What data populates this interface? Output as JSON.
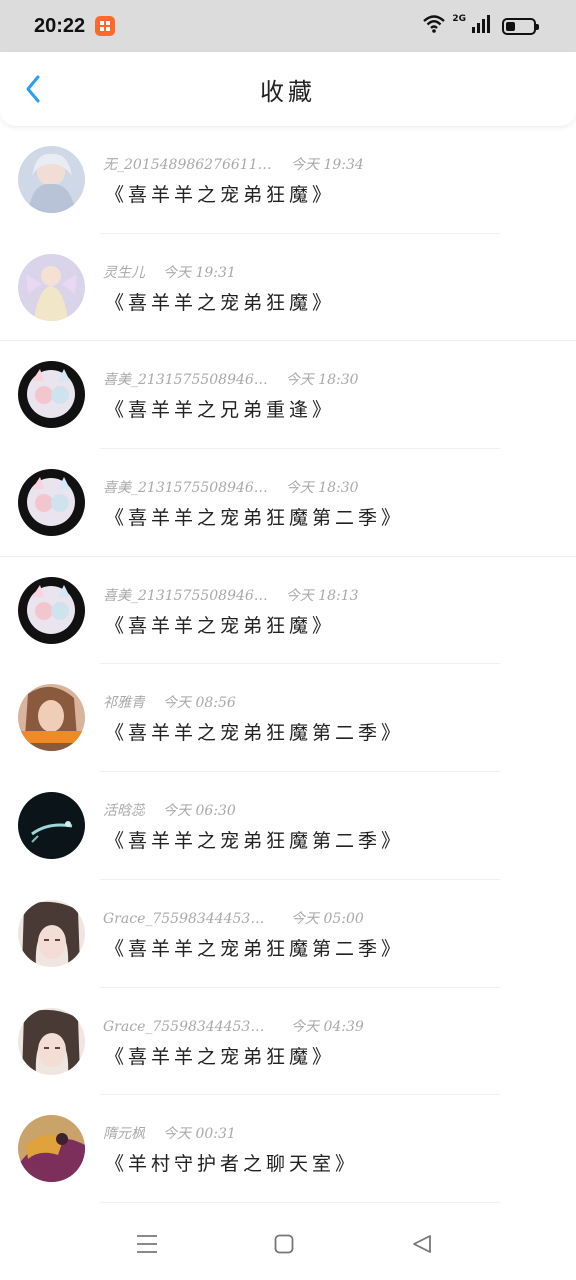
{
  "status_bar": {
    "time": "20:22",
    "network": "2G"
  },
  "header": {
    "title": "收藏"
  },
  "favorites": [
    {
      "name": "无_201548986276611157",
      "time": "今天 19:34",
      "title": "《喜羊羊之宠弟狂魔》"
    },
    {
      "name": "灵生儿",
      "time": "今天 19:31",
      "title": "《喜羊羊之宠弟狂魔》"
    },
    {
      "name": "喜美_2131575508946…",
      "time": "今天 18:30",
      "title": "《喜羊羊之兄弟重逢》"
    },
    {
      "name": "喜美_2131575508946…",
      "time": "今天 18:30",
      "title": "《喜羊羊之宠弟狂魔第二季》"
    },
    {
      "name": "喜美_2131575508946…",
      "time": "今天 18:13",
      "title": "《喜羊羊之宠弟狂魔》"
    },
    {
      "name": "祁雅青",
      "time": "今天 08:56",
      "title": "《喜羊羊之宠弟狂魔第二季》"
    },
    {
      "name": "活晗蕊",
      "time": "今天 06:30",
      "title": "《喜羊羊之宠弟狂魔第二季》"
    },
    {
      "name": "Grace_75598344453462",
      "time": "今天 05:00",
      "title": "《喜羊羊之宠弟狂魔第二季》"
    },
    {
      "name": "Grace_75598344453462",
      "time": "今天 04:39",
      "title": "《喜羊羊之宠弟狂魔》"
    },
    {
      "name": "隋元枫",
      "time": "今天 00:31",
      "title": "《羊村守护者之聊天室》"
    }
  ],
  "colors": {
    "accent": "#2a9df4",
    "meta_text": "#a9a9a9",
    "title_text": "#222222"
  }
}
